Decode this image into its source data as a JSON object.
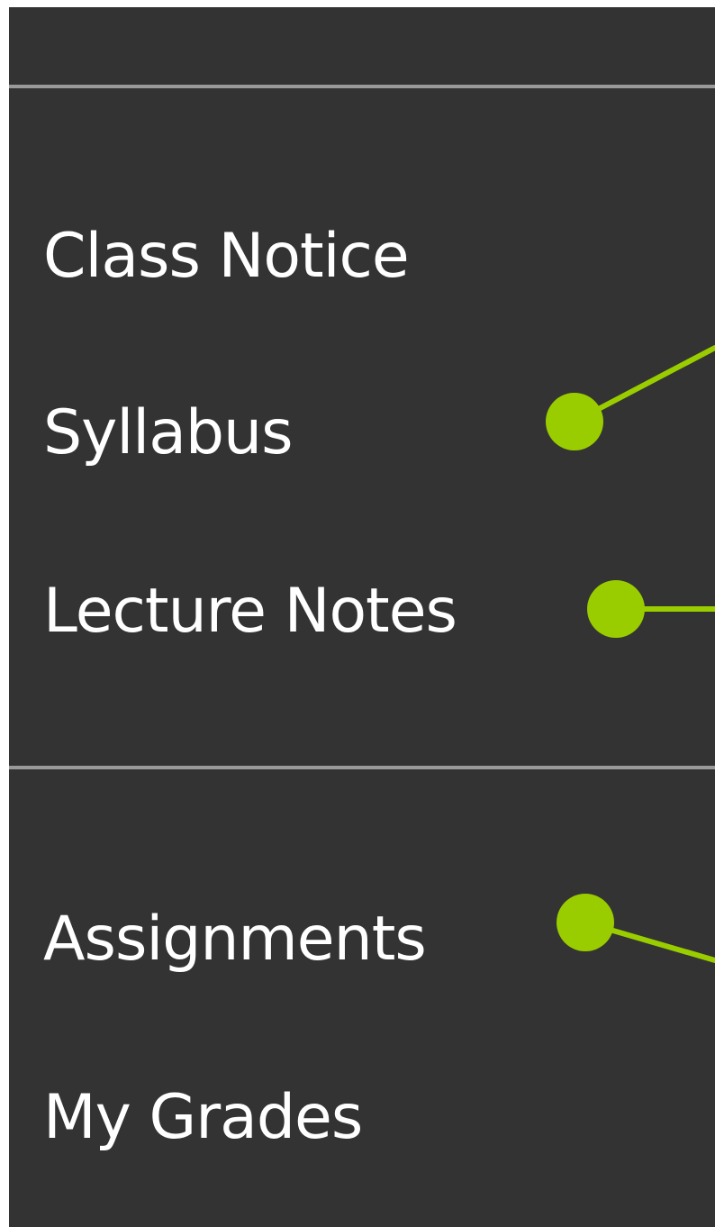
{
  "nav": {
    "items": [
      {
        "label": "Class Notice"
      },
      {
        "label": "Syllabus"
      },
      {
        "label": "Lecture Notes"
      },
      {
        "label": "Assignments"
      },
      {
        "label": "My Grades"
      }
    ]
  },
  "colors": {
    "panel_bg": "#333333",
    "divider": "#9a9a9a",
    "text": "#ffffff",
    "callout_accent": "#9acd00"
  },
  "icons": [
    "callout-dot-icon",
    "callout-line-icon"
  ]
}
